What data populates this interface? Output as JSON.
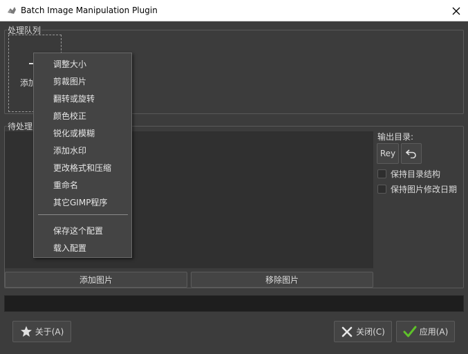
{
  "window": {
    "title": "Batch Image Manipulation Plugin"
  },
  "queue": {
    "label": "处理队列",
    "add_label": "添加"
  },
  "pending": {
    "label": "待处理"
  },
  "output": {
    "label": "输出目录:",
    "folder_button": "Rey",
    "keep_structure": "保持目录结构",
    "keep_date": "保持图片修改日期"
  },
  "buttons": {
    "add_images": "添加图片",
    "remove_images": "移除图片",
    "about": "关于(A)",
    "close": "关闭(C)",
    "apply": "应用(A)"
  },
  "menu": {
    "items": [
      "调整大小",
      "剪裁图片",
      "翻转或旋转",
      "颜色校正",
      "锐化或模糊",
      "添加水印",
      "更改格式和压缩",
      "重命名",
      "其它GIMP程序"
    ],
    "config_items": [
      "保存这个配置",
      "载入配置"
    ]
  },
  "colors": {
    "background": "#3c3c3c",
    "apply_check": "#5fc22a",
    "menu_bg": "#444444"
  },
  "icons": [
    "app-icon",
    "close-icon",
    "undo-icon",
    "star-icon",
    "x-icon",
    "check-icon"
  ]
}
